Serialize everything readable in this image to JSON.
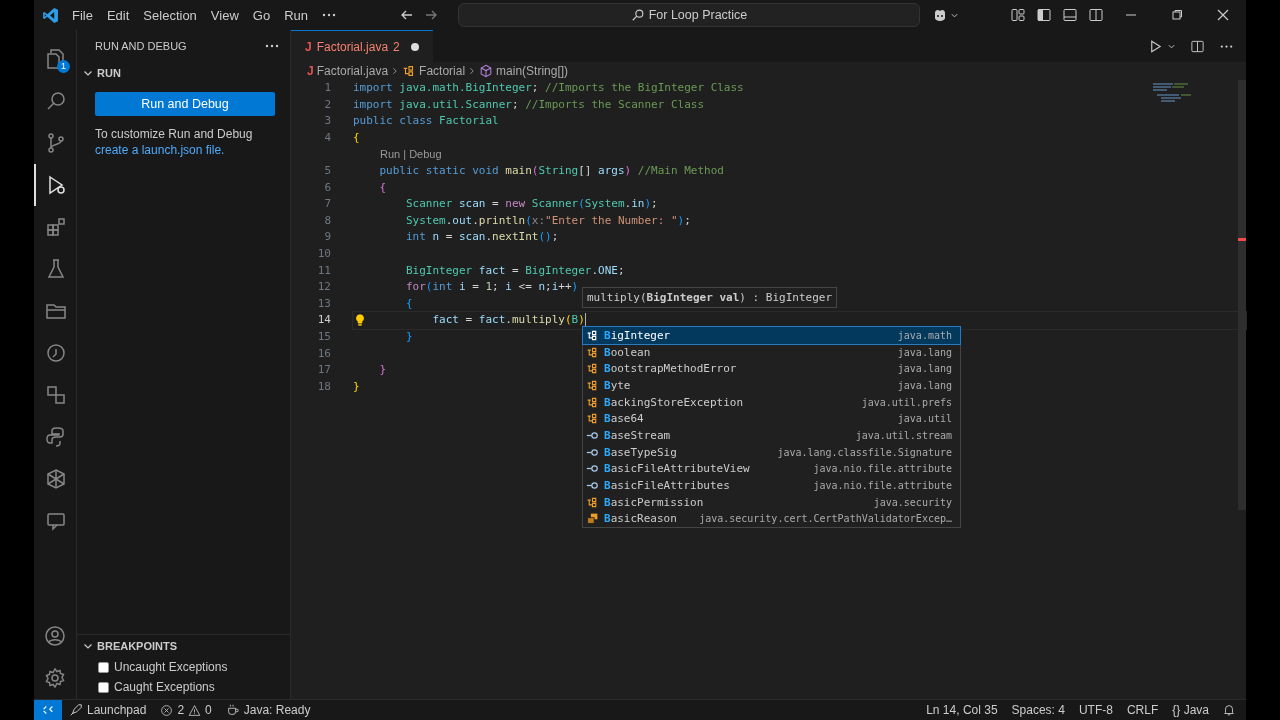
{
  "title_bar": {
    "menu": [
      "File",
      "Edit",
      "Selection",
      "View",
      "Go",
      "Run"
    ],
    "command_center": "For Loop Practice"
  },
  "activity_bar": {
    "items": [
      {
        "selected": false,
        "badge": "1"
      },
      {
        "selected": false
      },
      {
        "selected": false
      },
      {
        "selected": true
      },
      {
        "selected": false
      },
      {
        "selected": false
      },
      {
        "selected": false
      },
      {
        "selected": false
      },
      {
        "selected": false
      },
      {
        "selected": false
      },
      {
        "selected": false
      },
      {
        "selected": false
      }
    ]
  },
  "sidebar": {
    "title": "RUN AND DEBUG",
    "run_section": {
      "title": "RUN",
      "expanded": true,
      "button": "Run and Debug",
      "text": "To customize Run and Debug",
      "link": "create a launch.json file."
    },
    "breakpoints": {
      "title": "BREAKPOINTS",
      "expanded": true,
      "items": [
        {
          "label": "Uncaught Exceptions",
          "checked": false
        },
        {
          "label": "Caught Exceptions",
          "checked": false
        }
      ]
    }
  },
  "editor": {
    "tabs": [
      {
        "icon": "J",
        "label": "Factorial.java",
        "problems": "2",
        "dirty": true,
        "selected": true
      }
    ],
    "breadcrumbs": [
      {
        "kind": "file",
        "icon": "J",
        "label": "Factorial.java"
      },
      {
        "kind": "class",
        "label": "Factorial"
      },
      {
        "kind": "method",
        "label": "main(String[])"
      }
    ],
    "lines": [
      {
        "number": "1",
        "current": false,
        "tokens": [
          {
            "kind": "kw",
            "text": "import "
          },
          {
            "kind": "type",
            "text": "java.math.BigInteger"
          },
          {
            "kind": "plain",
            "text": "; "
          },
          {
            "kind": "com",
            "text": "//Imports the BigInteger Class"
          }
        ]
      },
      {
        "number": "2",
        "current": false,
        "tokens": [
          {
            "kind": "kw",
            "text": "import "
          },
          {
            "kind": "type",
            "text": "java.util.Scanner"
          },
          {
            "kind": "plain",
            "text": "; "
          },
          {
            "kind": "com",
            "text": "//Imports the Scanner Class"
          }
        ]
      },
      {
        "number": "3",
        "current": false,
        "tokens": [
          {
            "kind": "kw",
            "text": "public class "
          },
          {
            "kind": "type",
            "text": "Factorial"
          }
        ]
      },
      {
        "number": "4",
        "current": false,
        "tokens": [
          {
            "kind": "br1",
            "text": "{"
          }
        ]
      },
      {
        "number": "5",
        "current": false,
        "codelens": "Run | Debug",
        "tokens": [
          {
            "kind": "kw",
            "text": "    public static void "
          },
          {
            "kind": "fn",
            "text": "main"
          },
          {
            "kind": "br2",
            "text": "("
          },
          {
            "kind": "type",
            "text": "String"
          },
          {
            "kind": "plain",
            "text": "[] "
          },
          {
            "kind": "var",
            "text": "args"
          },
          {
            "kind": "br2",
            "text": ") "
          },
          {
            "kind": "com",
            "text": "//Main Method"
          }
        ]
      },
      {
        "number": "6",
        "current": false,
        "tokens": [
          {
            "kind": "br2",
            "text": "    {"
          }
        ]
      },
      {
        "number": "7",
        "current": false,
        "tokens": [
          {
            "kind": "type",
            "text": "        Scanner "
          },
          {
            "kind": "var",
            "text": "scan"
          },
          {
            "kind": "plain",
            "text": " = "
          },
          {
            "kind": "ctl",
            "text": "new "
          },
          {
            "kind": "type",
            "text": "Scanner"
          },
          {
            "kind": "br3",
            "text": "("
          },
          {
            "kind": "type",
            "text": "System"
          },
          {
            "kind": "plain",
            "text": "."
          },
          {
            "kind": "var",
            "text": "in"
          },
          {
            "kind": "br3",
            "text": ")"
          },
          {
            "kind": "plain",
            "text": ";"
          }
        ]
      },
      {
        "number": "8",
        "current": false,
        "tokens": [
          {
            "kind": "type",
            "text": "        System"
          },
          {
            "kind": "plain",
            "text": "."
          },
          {
            "kind": "var",
            "text": "out"
          },
          {
            "kind": "plain",
            "text": "."
          },
          {
            "kind": "fn",
            "text": "println"
          },
          {
            "kind": "br3",
            "text": "("
          },
          {
            "kind": "hint",
            "text": "x:"
          },
          {
            "kind": "str",
            "text": "\"Enter the Number: \""
          },
          {
            "kind": "br3",
            "text": ")"
          },
          {
            "kind": "plain",
            "text": ";"
          }
        ]
      },
      {
        "number": "9",
        "current": false,
        "tokens": [
          {
            "kind": "kw",
            "text": "        int "
          },
          {
            "kind": "var",
            "text": "n"
          },
          {
            "kind": "plain",
            "text": " = "
          },
          {
            "kind": "var",
            "text": "scan"
          },
          {
            "kind": "plain",
            "text": "."
          },
          {
            "kind": "fn",
            "text": "nextInt"
          },
          {
            "kind": "br3",
            "text": "()"
          },
          {
            "kind": "plain",
            "text": ";"
          }
        ]
      },
      {
        "number": "10",
        "current": false
      },
      {
        "number": "11",
        "current": false,
        "tokens": [
          {
            "kind": "type",
            "text": "        BigInteger "
          },
          {
            "kind": "var",
            "text": "fact"
          },
          {
            "kind": "plain",
            "text": " = "
          },
          {
            "kind": "type",
            "text": "BigInteger"
          },
          {
            "kind": "plain",
            "text": "."
          },
          {
            "kind": "var",
            "text": "ONE"
          },
          {
            "kind": "plain",
            "text": ";"
          }
        ]
      },
      {
        "number": "12",
        "current": false,
        "tokens": [
          {
            "kind": "ctl",
            "text": "        for"
          },
          {
            "kind": "br3",
            "text": "("
          },
          {
            "kind": "kw",
            "text": "int "
          },
          {
            "kind": "var",
            "text": "i"
          },
          {
            "kind": "plain",
            "text": " = "
          },
          {
            "kind": "num",
            "text": "1"
          },
          {
            "kind": "plain",
            "text": "; "
          },
          {
            "kind": "var",
            "text": "i"
          },
          {
            "kind": "plain",
            "text": " <= "
          },
          {
            "kind": "var",
            "text": "n"
          },
          {
            "kind": "plain",
            "text": ";"
          },
          {
            "kind": "var",
            "text": "i"
          },
          {
            "kind": "plain",
            "text": "++"
          },
          {
            "kind": "br3",
            "text": ")"
          }
        ]
      },
      {
        "number": "13",
        "current": false,
        "tokens": [
          {
            "kind": "br3",
            "text": "        {"
          }
        ]
      },
      {
        "number": "14",
        "current": true,
        "tokens": [
          {
            "kind": "var",
            "text": "            fact"
          },
          {
            "kind": "plain",
            "text": " = "
          },
          {
            "kind": "var",
            "text": "fact"
          },
          {
            "kind": "plain",
            "text": "."
          },
          {
            "kind": "fn",
            "text": "multiply"
          },
          {
            "kind": "br1",
            "text": "("
          },
          {
            "kind": "type",
            "text": "B"
          },
          {
            "kind": "br1",
            "text": ")"
          }
        ]
      },
      {
        "number": "15",
        "current": false,
        "tokens": [
          {
            "kind": "br3",
            "text": "        }"
          }
        ]
      },
      {
        "number": "16",
        "current": false
      },
      {
        "number": "17",
        "current": false,
        "tokens": [
          {
            "kind": "br2",
            "text": "    }"
          }
        ]
      },
      {
        "number": "18",
        "current": false,
        "tokens": [
          {
            "kind": "br1",
            "text": "}"
          }
        ]
      }
    ],
    "signature_hint": "multiply(**BigInteger val**) : BigInteger",
    "suggestions": [
      {
        "kind": "class",
        "match": "B",
        "rest": "igInteger",
        "detail": "java.math",
        "selected": true
      },
      {
        "kind": "class",
        "match": "B",
        "rest": "oolean",
        "detail": "java.lang",
        "selected": false
      },
      {
        "kind": "class",
        "match": "B",
        "rest": "ootstrapMethodError",
        "detail": "java.lang",
        "selected": false
      },
      {
        "kind": "class",
        "match": "B",
        "rest": "yte",
        "detail": "java.lang",
        "selected": false
      },
      {
        "kind": "class",
        "match": "B",
        "rest": "ackingStoreException",
        "detail": "java.util.prefs",
        "selected": false
      },
      {
        "kind": "class",
        "match": "B",
        "rest": "ase64",
        "detail": "java.util",
        "selected": false
      },
      {
        "kind": "interface",
        "match": "B",
        "rest": "aseStream",
        "detail": "java.util.stream",
        "selected": false
      },
      {
        "kind": "interface",
        "match": "B",
        "rest": "aseTypeSig",
        "detail": "java.lang.classfile.Signature",
        "selected": false
      },
      {
        "kind": "interface",
        "match": "B",
        "rest": "asicFileAttributeView",
        "detail": "java.nio.file.attribute",
        "selected": false
      },
      {
        "kind": "interface",
        "match": "B",
        "rest": "asicFileAttributes",
        "detail": "java.nio.file.attribute",
        "selected": false
      },
      {
        "kind": "class",
        "match": "B",
        "rest": "asicPermission",
        "detail": "java.security",
        "selected": false
      },
      {
        "kind": "enum",
        "match": "B",
        "rest": "asicReason",
        "detail": "java.security.cert.CertPathValidatorExcep…",
        "selected": false
      }
    ]
  },
  "status_bar": {
    "launchpad": "Launchpad",
    "errors": "2",
    "warnings": "0",
    "java_status": "Java: Ready",
    "position": "Ln 14, Col 35",
    "spaces": "Spaces: 4",
    "encoding": "UTF-8",
    "eol": "CRLF",
    "language_icon": "{}",
    "language": "Java"
  }
}
